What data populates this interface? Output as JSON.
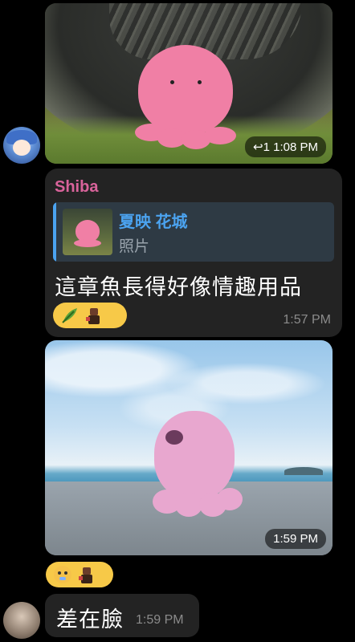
{
  "messages": {
    "image1": {
      "time": "↩1 1:08 PM"
    },
    "text1": {
      "sender": "Shiba",
      "reply": {
        "name": "夏映 花城",
        "text": "照片"
      },
      "body": "這章魚長得好像情趣用品",
      "time": "1:57 PM",
      "reactions": [
        "herb-icon",
        "figure-icon"
      ]
    },
    "image2": {
      "time": "1:59 PM",
      "reactions": [
        "baby-face-icon",
        "figure-icon"
      ]
    },
    "text2": {
      "body": "差在臉",
      "time": "1:59 PM"
    }
  },
  "colors": {
    "background": "#000000",
    "bubble": "#232323",
    "sender": "#d9639b",
    "reply_accent": "#4ba3f0",
    "reaction_bg": "#f7c948",
    "octopus": "#f07fa5"
  }
}
